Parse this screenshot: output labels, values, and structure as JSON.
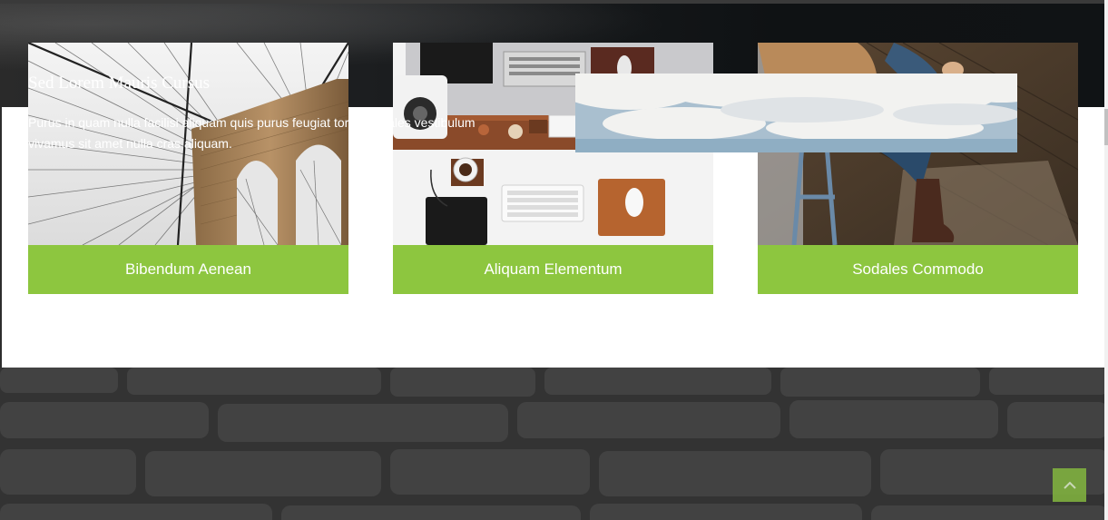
{
  "cards": [
    {
      "label": "Bibendum Aenean",
      "image_icon": "bridge-photo"
    },
    {
      "label": "Aliquam Elementum",
      "image_icon": "desk-photo"
    },
    {
      "label": "Sodales Commodo",
      "image_icon": "boots-photo"
    }
  ],
  "feature": {
    "title": "Sed Lorem Mauris Cursus",
    "text": "Purus in quam nulla facilisi aliquam quis purus feugiat tortor sodales vestibulum vivamus sit amet nulla cras aliquam.",
    "image_icon": "sky-photo"
  },
  "scroll_top": {
    "icon": "chevron-up-icon"
  },
  "colors": {
    "accent": "#8dc63f",
    "dark": "#1b1d1f"
  }
}
